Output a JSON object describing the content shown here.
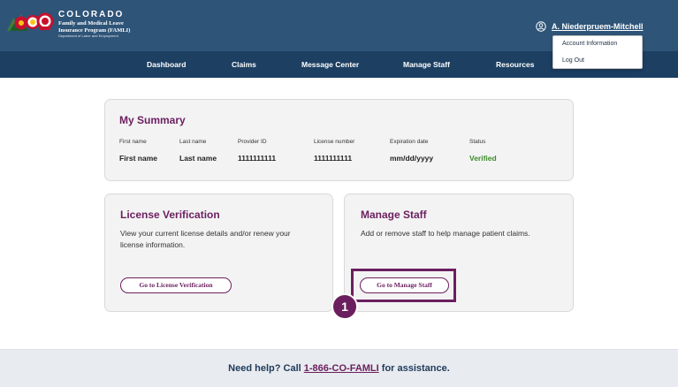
{
  "header": {
    "brand_name": "COLORADO",
    "brand_line1": "Family and Medical Leave",
    "brand_line2": "Insurance Program (FAMLI)",
    "brand_dept": "Department of Labor and Employment",
    "user_name": "A. Niederpruem-Mitchell"
  },
  "user_menu": {
    "items": [
      {
        "label": "Account Information"
      },
      {
        "label": "Log Out"
      }
    ]
  },
  "nav": {
    "items": [
      {
        "label": "Dashboard"
      },
      {
        "label": "Claims"
      },
      {
        "label": "Message Center"
      },
      {
        "label": "Manage Staff"
      },
      {
        "label": "Resources"
      }
    ]
  },
  "summary": {
    "title": "My Summary",
    "fields": [
      {
        "label": "First name",
        "value": "First name"
      },
      {
        "label": "Last name",
        "value": "Last name"
      },
      {
        "label": "Provider ID",
        "value": "1111111111"
      },
      {
        "label": "License number",
        "value": "1111111111"
      },
      {
        "label": "Expiration date",
        "value": "mm/dd/yyyy"
      },
      {
        "label": "Status",
        "value": "Verified"
      }
    ]
  },
  "license_card": {
    "title": "License Verification",
    "description": "View your current license details and/or renew your license information.",
    "button_label": "Go to License Verification"
  },
  "staff_card": {
    "title": "Manage Staff",
    "description": "Add or remove staff to help manage patient claims.",
    "button_label": "Go to Manage Staff"
  },
  "step_badge": "1",
  "footer": {
    "prefix": "Need help? Call ",
    "phone": "1-866-CO-FAMLI",
    "suffix": " for assistance."
  },
  "colors": {
    "header_bg": "#2e5478",
    "nav_bg": "#1c3f62",
    "accent": "#6b1f5e",
    "status_verified": "#3f8b2a"
  }
}
